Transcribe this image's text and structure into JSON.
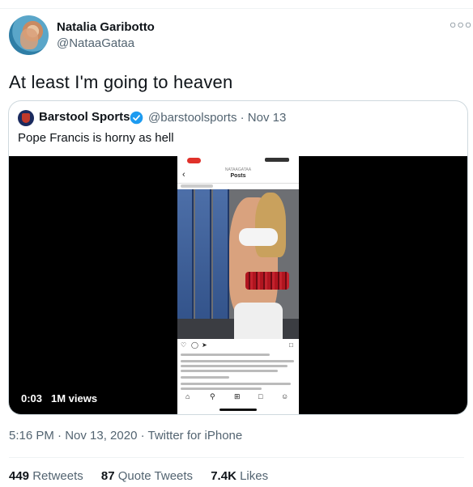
{
  "author": {
    "name": "Natalia Garibotto",
    "handle": "@NataaGataa",
    "more_icon": "more-horizontal-icon"
  },
  "tweet": {
    "text": "At least I'm going to heaven"
  },
  "quoted": {
    "name": "Barstool Sports",
    "verified": true,
    "handle_date": "@barstoolsports · Nov 13",
    "text": "Pope Francis is horny as hell",
    "video": {
      "time": "0:03",
      "views": "1M views",
      "phone_username": "NATAAGATAA",
      "phone_title": "Posts"
    }
  },
  "meta": {
    "time_date": "5:16 PM · Nov 13, 2020",
    "separator": " · ",
    "source": "Twitter for iPhone"
  },
  "stats": {
    "retweets_count": "449",
    "retweets_label": "Retweets",
    "quote_count": "87",
    "quote_label": "Quote Tweets",
    "likes_count": "7.4K",
    "likes_label": "Likes"
  },
  "colors": {
    "verified": "#1d9bf0",
    "secondary_text": "#536471",
    "primary_text": "#0f1419"
  }
}
